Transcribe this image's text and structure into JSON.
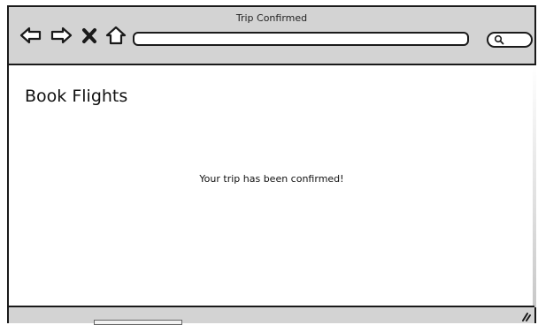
{
  "window": {
    "title": "Trip Confirmed"
  },
  "toolbar": {
    "back_icon": "arrow-left-icon",
    "forward_icon": "arrow-right-icon",
    "stop_icon": "close-icon",
    "home_icon": "home-icon",
    "address_value": "",
    "search_icon": "search-icon"
  },
  "page": {
    "title": "Book Flights",
    "message": "Your trip has been confirmed!"
  },
  "colors": {
    "chrome": "#d3d3d3",
    "border": "#1a1a1a",
    "background": "#ffffff"
  }
}
